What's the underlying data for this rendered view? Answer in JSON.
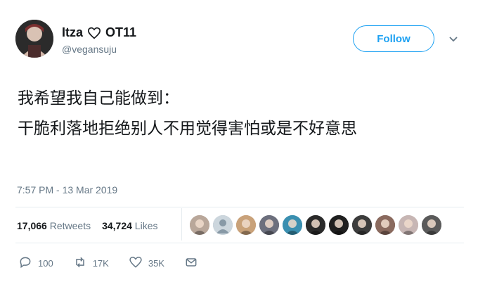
{
  "tweet": {
    "display_name": "Itza",
    "name_suffix": "OT11",
    "handle": "@vegansuju",
    "follow_label": "Follow",
    "text_line1": "我希望我自己能做到：",
    "text_line2": "干脆利落地拒绝别人不用觉得害怕或是不好意思",
    "timestamp": "7:57 PM - 13 Mar 2019"
  },
  "stats": {
    "retweets_count": "17,066",
    "retweets_label": "Retweets",
    "likes_count": "34,724",
    "likes_label": "Likes"
  },
  "likers": [
    {
      "icon": "liker-avatar",
      "color": "#b9a79a"
    },
    {
      "icon": "default-avatar",
      "color": "#aab8c2"
    },
    {
      "icon": "liker-avatar",
      "color": "#c9a27a"
    },
    {
      "icon": "liker-avatar",
      "color": "#6c6f7d"
    },
    {
      "icon": "liker-avatar",
      "color": "#3a8fb0"
    },
    {
      "icon": "liker-avatar",
      "color": "#2a2a2a"
    },
    {
      "icon": "liker-avatar",
      "color": "#1f1f1f"
    },
    {
      "icon": "liker-avatar",
      "color": "#3c3c3c"
    },
    {
      "icon": "liker-avatar",
      "color": "#8a6a5e"
    },
    {
      "icon": "liker-avatar",
      "color": "#c7b6b4"
    },
    {
      "icon": "liker-avatar",
      "color": "#5a5a5a"
    }
  ],
  "actions": {
    "reply_count": "100",
    "retweet_count": "17K",
    "like_count": "35K"
  },
  "colors": {
    "accent": "#1da1f2",
    "muted": "#657786",
    "text": "#14171a"
  }
}
